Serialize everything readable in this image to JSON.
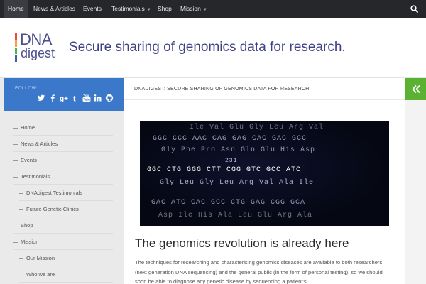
{
  "topnav": {
    "items": [
      {
        "label": "Home",
        "active": true
      },
      {
        "label": "News & Articles"
      },
      {
        "label": "Events"
      },
      {
        "label": "Testimonials",
        "dropdown": true
      },
      {
        "label": "Shop"
      },
      {
        "label": "Mission",
        "dropdown": true
      }
    ],
    "search_icon": "search-icon"
  },
  "header": {
    "logo_line1": "DNA",
    "logo_line2": "digest",
    "tagline": "Secure sharing of genomics data for research."
  },
  "sidebar": {
    "follow_label": "FOLLOW:",
    "social_icons": [
      "twitter-icon",
      "facebook-icon",
      "google-plus-icon",
      "tumblr-icon",
      "youtube-icon",
      "linkedin-icon",
      "github-icon"
    ],
    "nav": [
      {
        "label": "Home",
        "level": 1
      },
      {
        "label": "News & Articles",
        "level": 1
      },
      {
        "label": "Events",
        "level": 1
      },
      {
        "label": "Testimonials",
        "level": 1
      },
      {
        "label": "DNAdigest Testimonials",
        "level": 2
      },
      {
        "label": "Future Genetic Clinics",
        "level": 2
      },
      {
        "label": "Shop",
        "level": 1
      },
      {
        "label": "Mission",
        "level": 1
      },
      {
        "label": "Our Mission",
        "level": 2
      },
      {
        "label": "Who we are",
        "level": 2
      }
    ]
  },
  "content": {
    "breadcrumb": "DNADIGEST: SECURE SHARING OF GENOMICS DATA FOR RESEARCH",
    "hero_lines": [
      "Ile Val Glu Gly Leu Arg Val",
      "GGC CCC AAC CAG GAG CAC GAC GCC",
      "Gly Phe Pro Asn Gln Glu His Asp",
      "231",
      "GGC CTG GGG CTT CGG GTC GCC ATC",
      "Gly Leu Gly Leu Arg Val Ala Ile",
      "GAC ATC CAC GCC CTG GAG CGG GCA",
      "Asp Ile His Ala Leu Glu Arg Ala"
    ],
    "headline": "The genomics revolution is already here",
    "body": "The techniques for researching and characterising genomics diseases are available to both researchers (next generation DNA sequencing) and the general public (in the form of personal testing), so we should soon be able to diagnose any genetic disease by sequencing a patient's"
  },
  "right_rail": {
    "toggle_icon": "double-chevron-left-icon"
  },
  "colors": {
    "nav_bg": "#26272b",
    "follow_bg": "#3b78c9",
    "toggle_bg": "#5bb232",
    "brand": "#3f4184"
  }
}
